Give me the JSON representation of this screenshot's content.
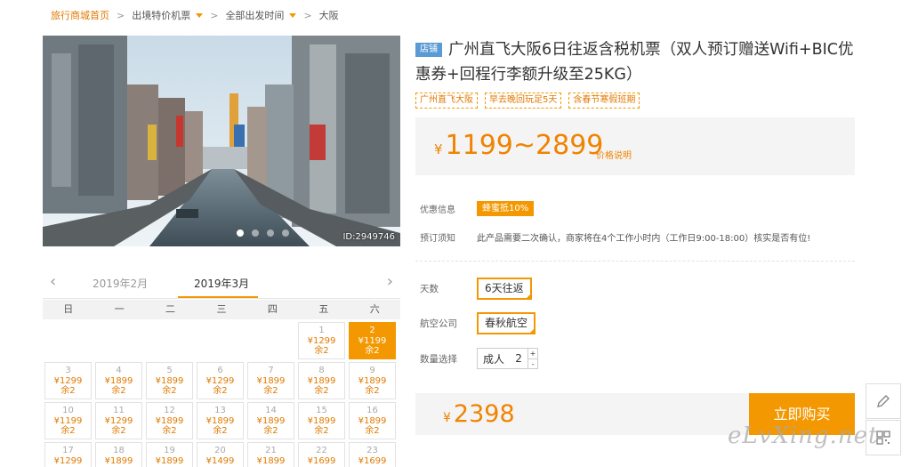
{
  "breadcrumb": {
    "home": "旅行商城首页",
    "item2": "出境特价机票",
    "item3": "全部出发时间",
    "item4": "大阪"
  },
  "hero": {
    "photo_id": "ID:2949746",
    "dots_count": 4,
    "active_dot": 0
  },
  "product": {
    "store_tag": "店铺",
    "title": "广州直飞大阪6日往返含税机票（双人预订赠送Wifi+BIC优惠券+回程行李额升级至25KG）",
    "tags": [
      "广州直飞大阪",
      "早去晚回玩足5天",
      "含春节寒假班期"
    ]
  },
  "price": {
    "currency": "¥",
    "range": "1199~2899",
    "note": "价格说明"
  },
  "info": {
    "discount_label": "优惠信息",
    "discount_badge": "蜂蜜抵10%",
    "notice_label": "预订须知",
    "notice_text": "此产品需要二次确认，商家将在4个工作小时内（工作日9:00-18:00）核实是否有位!"
  },
  "options": {
    "days_label": "天数",
    "days_value": "6天往返",
    "airline_label": "航空公司",
    "airline_value": "春秋航空",
    "qty_label": "数量选择",
    "qty_type": "成人",
    "qty_value": "2",
    "plus": "+",
    "minus": "-"
  },
  "total": {
    "currency": "¥",
    "amount": "2398",
    "buy_label": "立即购买"
  },
  "calendar": {
    "prev_month": "2019年2月",
    "current_month": "2019年3月",
    "weekdays": [
      "日",
      "一",
      "二",
      "三",
      "四",
      "五",
      "六"
    ],
    "cells": [
      null,
      null,
      null,
      null,
      null,
      {
        "day": "1",
        "price": "¥1299",
        "remain": "余2"
      },
      {
        "day": "2",
        "price": "¥1199",
        "remain": "余2",
        "selected": true
      },
      {
        "day": "3",
        "price": "¥1299",
        "remain": "余2"
      },
      {
        "day": "4",
        "price": "¥1899",
        "remain": "余2"
      },
      {
        "day": "5",
        "price": "¥1899",
        "remain": "余2"
      },
      {
        "day": "6",
        "price": "¥1299",
        "remain": "余2"
      },
      {
        "day": "7",
        "price": "¥1899",
        "remain": "余2"
      },
      {
        "day": "8",
        "price": "¥1899",
        "remain": "余2"
      },
      {
        "day": "9",
        "price": "¥1899",
        "remain": "余2"
      },
      {
        "day": "10",
        "price": "¥1199",
        "remain": "余2"
      },
      {
        "day": "11",
        "price": "¥1299",
        "remain": "余2"
      },
      {
        "day": "12",
        "price": "¥1899",
        "remain": "余2"
      },
      {
        "day": "13",
        "price": "¥1899",
        "remain": "余2"
      },
      {
        "day": "14",
        "price": "¥1899",
        "remain": "余2"
      },
      {
        "day": "15",
        "price": "¥1899",
        "remain": "余2"
      },
      {
        "day": "16",
        "price": "¥1899",
        "remain": "余2"
      },
      {
        "day": "17",
        "price": "¥1299",
        "remain": ""
      },
      {
        "day": "18",
        "price": "¥1899",
        "remain": ""
      },
      {
        "day": "19",
        "price": "¥1899",
        "remain": ""
      },
      {
        "day": "20",
        "price": "¥1499",
        "remain": ""
      },
      {
        "day": "21",
        "price": "¥1899",
        "remain": ""
      },
      {
        "day": "22",
        "price": "¥1699",
        "remain": ""
      },
      {
        "day": "23",
        "price": "¥1699",
        "remain": ""
      }
    ]
  },
  "watermark": "eLvXing.net",
  "icons": {
    "edit": "pencil-icon",
    "qr": "qr-code-icon"
  },
  "colors": {
    "accent": "#f39800",
    "price": "#f08300",
    "store_tag": "#5a9bd5"
  }
}
